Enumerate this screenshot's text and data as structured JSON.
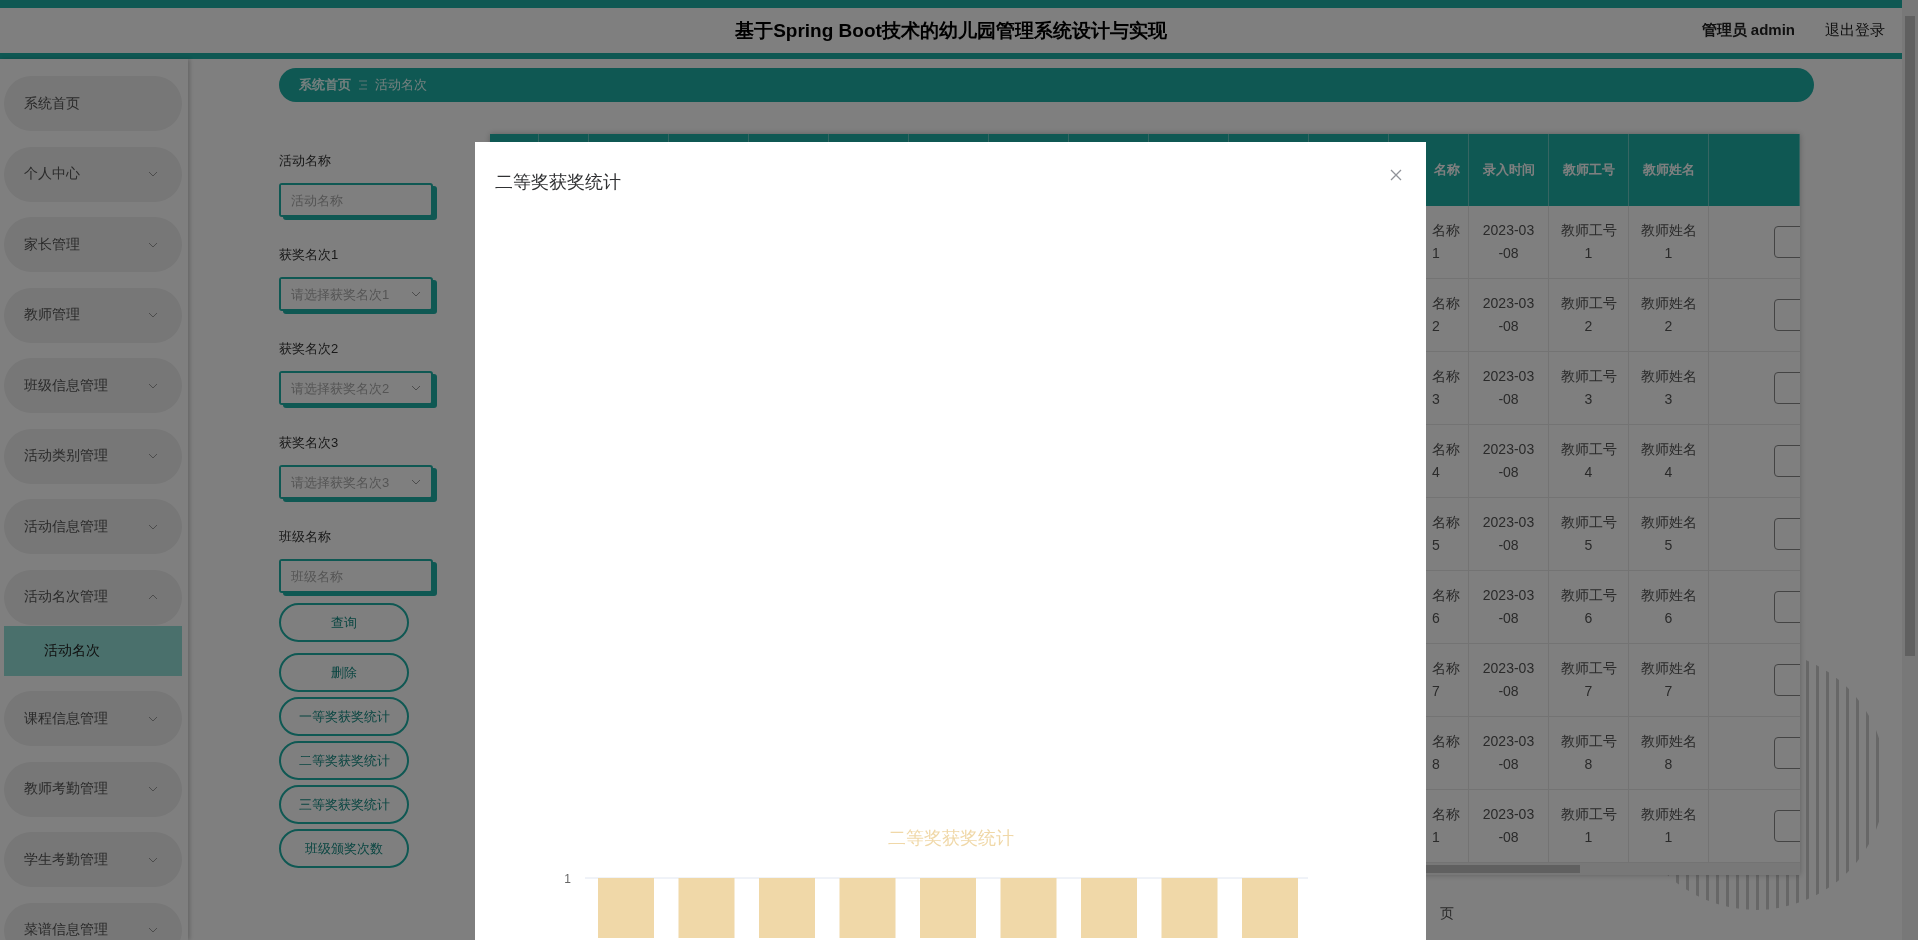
{
  "header": {
    "title": "基于Spring Boot技术的幼儿园管理系统设计与实现",
    "user": "管理员 admin",
    "logout": "退出登录"
  },
  "sidebar": {
    "items": [
      {
        "label": "系统首页",
        "kind": "link"
      },
      {
        "label": "个人中心",
        "kind": "menu",
        "expanded": false
      },
      {
        "label": "家长管理",
        "kind": "menu",
        "expanded": false
      },
      {
        "label": "教师管理",
        "kind": "menu",
        "expanded": false
      },
      {
        "label": "班级信息管理",
        "kind": "menu",
        "expanded": false
      },
      {
        "label": "活动类别管理",
        "kind": "menu",
        "expanded": false
      },
      {
        "label": "活动信息管理",
        "kind": "menu",
        "expanded": false
      },
      {
        "label": "活动名次管理",
        "kind": "menu",
        "expanded": true,
        "children": [
          {
            "label": "活动名次",
            "selected": true
          }
        ]
      },
      {
        "label": "课程信息管理",
        "kind": "menu",
        "expanded": false
      },
      {
        "label": "教师考勤管理",
        "kind": "menu",
        "expanded": false
      },
      {
        "label": "学生考勤管理",
        "kind": "menu",
        "expanded": false
      },
      {
        "label": "菜谱信息管理",
        "kind": "menu",
        "expanded": false
      }
    ]
  },
  "breadcrumb": [
    "系统首页",
    "活动名次"
  ],
  "search_form": {
    "fields": [
      {
        "label": "活动名称",
        "kind": "input",
        "placeholder": "活动名称"
      },
      {
        "label": "获奖名次1",
        "kind": "select",
        "placeholder": "请选择获奖名次1"
      },
      {
        "label": "获奖名次2",
        "kind": "select",
        "placeholder": "请选择获奖名次2"
      },
      {
        "label": "获奖名次3",
        "kind": "select",
        "placeholder": "请选择获奖名次3"
      },
      {
        "label": "班级名称",
        "kind": "input",
        "placeholder": "班级名称"
      }
    ],
    "buttons": [
      "查询",
      "删除",
      "一等奖获奖统计",
      "二等奖获奖统计",
      "三等奖获奖统计",
      "班级颁奖次数"
    ]
  },
  "table": {
    "columns": [
      "名称",
      "录入时间",
      "教师工号",
      "教师姓名"
    ],
    "rows": [
      {
        "cells": [
          "名称1",
          "2023-03-08",
          "教师工号1",
          "教师姓名1"
        ]
      },
      {
        "cells": [
          "名称2",
          "2023-03-08",
          "教师工号2",
          "教师姓名2"
        ]
      },
      {
        "cells": [
          "名称3",
          "2023-03-08",
          "教师工号3",
          "教师姓名3"
        ]
      },
      {
        "cells": [
          "名称4",
          "2023-03-08",
          "教师工号4",
          "教师姓名4"
        ]
      },
      {
        "cells": [
          "名称5",
          "2023-03-08",
          "教师工号5",
          "教师姓名5"
        ]
      },
      {
        "cells": [
          "名称6",
          "2023-03-08",
          "教师工号6",
          "教师姓名6"
        ]
      },
      {
        "cells": [
          "名称7",
          "2023-03-08",
          "教师工号7",
          "教师姓名7"
        ]
      },
      {
        "cells": [
          "名称8",
          "2023-03-08",
          "教师工号8",
          "教师姓名8"
        ]
      },
      {
        "cells": [
          "名称1",
          "2023-03-08",
          "教师工号1",
          "教师姓名1"
        ]
      }
    ]
  },
  "pagination": {
    "suffix": "页"
  },
  "modal": {
    "title": "二等奖获奖统计",
    "chart_title": "二等奖获奖统计",
    "y_tick": "1"
  }
}
